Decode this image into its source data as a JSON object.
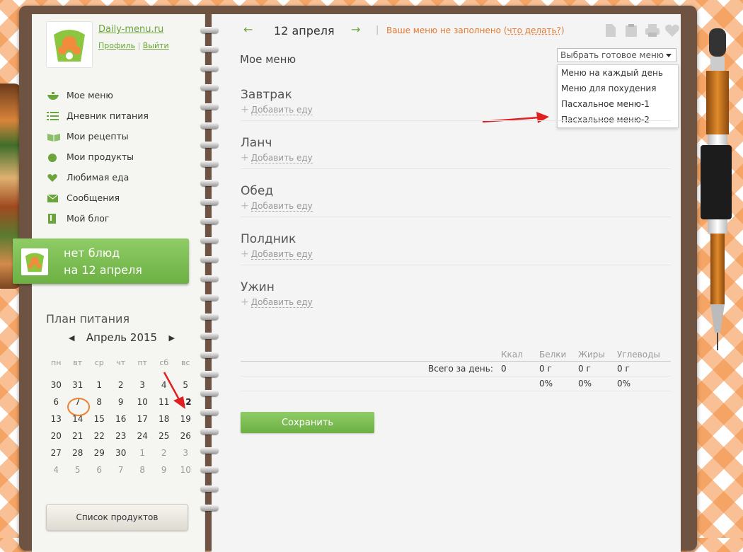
{
  "site": {
    "name": "Daily-menu.ru",
    "profile": "Профиль",
    "logout": "Выйти"
  },
  "nav": [
    {
      "label": "Мое меню",
      "icon": "bowl-icon"
    },
    {
      "label": "Дневник питания",
      "icon": "list-icon"
    },
    {
      "label": "Мои рецепты",
      "icon": "book-icon"
    },
    {
      "label": "Мои продукты",
      "icon": "apple-icon"
    },
    {
      "label": "Любимая еда",
      "icon": "heart-icon"
    },
    {
      "label": "Сообщения",
      "icon": "envelope-icon"
    },
    {
      "label": "Мой блог",
      "icon": "blog-icon"
    }
  ],
  "banner": {
    "line1": "нет блюд",
    "line2": "на 12 апреля"
  },
  "plan": {
    "title": "План питания",
    "month": "Апрель 2015",
    "prev": "◀",
    "next": "▶"
  },
  "calendar": {
    "weekdays": [
      "пн",
      "вт",
      "ср",
      "чт",
      "пт",
      "сб",
      "вс"
    ],
    "weeks": [
      [
        "30",
        "31",
        "1",
        "2",
        "3",
        "4",
        "5"
      ],
      [
        "6",
        "7",
        "8",
        "9",
        "10",
        "11",
        "12"
      ],
      [
        "13",
        "14",
        "15",
        "16",
        "17",
        "18",
        "19"
      ],
      [
        "20",
        "21",
        "22",
        "23",
        "24",
        "25",
        "26"
      ],
      [
        "27",
        "28",
        "29",
        "30",
        "1",
        "2",
        "3"
      ],
      [
        "4",
        "5",
        "6",
        "7",
        "8",
        "9",
        "10"
      ]
    ]
  },
  "shopping_list": "Список продуктов",
  "header": {
    "prev_arrow": "←",
    "date": "12 апреля",
    "next_arrow": "→",
    "separator": "|",
    "warning": "Ваше меню не заполнено (",
    "warning_link": "что делать?",
    "warning_end": ")"
  },
  "menu_title": "Мое меню",
  "ready_menu": {
    "selected": "Выбрать готовое меню",
    "options": [
      "Меню на каждый день",
      "Меню для похудения",
      "Пасхальное меню-1",
      "Пасхальное меню-2"
    ]
  },
  "meals": [
    {
      "name": "Завтрак",
      "add": "Добавить еду"
    },
    {
      "name": "Ланч",
      "add": "Добавить еду"
    },
    {
      "name": "Обед",
      "add": "Добавить еду"
    },
    {
      "name": "Полдник",
      "add": "Добавить еду"
    },
    {
      "name": "Ужин",
      "add": "Добавить еду"
    }
  ],
  "nutrition": {
    "headers": [
      "Ккал",
      "Белки",
      "Жиры",
      "Углеводы"
    ],
    "total_label": "Всего за день:",
    "values": [
      "0",
      "0 г",
      "0 г",
      "0 г"
    ],
    "percents": [
      "0%",
      "0%",
      "0%"
    ]
  },
  "save_label": "Сохранить",
  "colors": {
    "accent_green": "#6cb043",
    "warning_orange": "#e27a32",
    "annotation_red": "#e02020",
    "circle_orange": "#f08030"
  }
}
